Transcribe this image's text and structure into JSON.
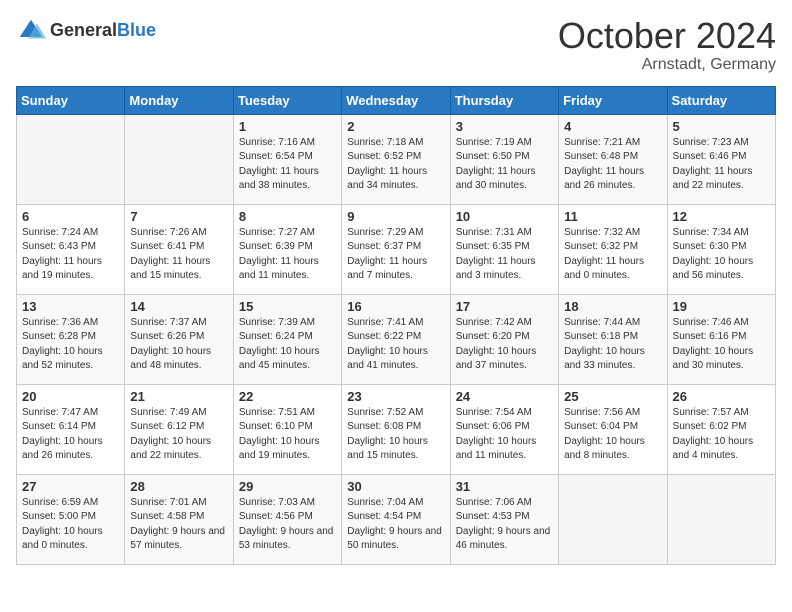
{
  "header": {
    "logo_general": "General",
    "logo_blue": "Blue",
    "month_title": "October 2024",
    "location": "Arnstadt, Germany"
  },
  "days_of_week": [
    "Sunday",
    "Monday",
    "Tuesday",
    "Wednesday",
    "Thursday",
    "Friday",
    "Saturday"
  ],
  "weeks": [
    [
      {
        "date": "",
        "info": ""
      },
      {
        "date": "",
        "info": ""
      },
      {
        "date": "1",
        "info": "Sunrise: 7:16 AM\nSunset: 6:54 PM\nDaylight: 11 hours and 38 minutes."
      },
      {
        "date": "2",
        "info": "Sunrise: 7:18 AM\nSunset: 6:52 PM\nDaylight: 11 hours and 34 minutes."
      },
      {
        "date": "3",
        "info": "Sunrise: 7:19 AM\nSunset: 6:50 PM\nDaylight: 11 hours and 30 minutes."
      },
      {
        "date": "4",
        "info": "Sunrise: 7:21 AM\nSunset: 6:48 PM\nDaylight: 11 hours and 26 minutes."
      },
      {
        "date": "5",
        "info": "Sunrise: 7:23 AM\nSunset: 6:46 PM\nDaylight: 11 hours and 22 minutes."
      }
    ],
    [
      {
        "date": "6",
        "info": "Sunrise: 7:24 AM\nSunset: 6:43 PM\nDaylight: 11 hours and 19 minutes."
      },
      {
        "date": "7",
        "info": "Sunrise: 7:26 AM\nSunset: 6:41 PM\nDaylight: 11 hours and 15 minutes."
      },
      {
        "date": "8",
        "info": "Sunrise: 7:27 AM\nSunset: 6:39 PM\nDaylight: 11 hours and 11 minutes."
      },
      {
        "date": "9",
        "info": "Sunrise: 7:29 AM\nSunset: 6:37 PM\nDaylight: 11 hours and 7 minutes."
      },
      {
        "date": "10",
        "info": "Sunrise: 7:31 AM\nSunset: 6:35 PM\nDaylight: 11 hours and 3 minutes."
      },
      {
        "date": "11",
        "info": "Sunrise: 7:32 AM\nSunset: 6:32 PM\nDaylight: 11 hours and 0 minutes."
      },
      {
        "date": "12",
        "info": "Sunrise: 7:34 AM\nSunset: 6:30 PM\nDaylight: 10 hours and 56 minutes."
      }
    ],
    [
      {
        "date": "13",
        "info": "Sunrise: 7:36 AM\nSunset: 6:28 PM\nDaylight: 10 hours and 52 minutes."
      },
      {
        "date": "14",
        "info": "Sunrise: 7:37 AM\nSunset: 6:26 PM\nDaylight: 10 hours and 48 minutes."
      },
      {
        "date": "15",
        "info": "Sunrise: 7:39 AM\nSunset: 6:24 PM\nDaylight: 10 hours and 45 minutes."
      },
      {
        "date": "16",
        "info": "Sunrise: 7:41 AM\nSunset: 6:22 PM\nDaylight: 10 hours and 41 minutes."
      },
      {
        "date": "17",
        "info": "Sunrise: 7:42 AM\nSunset: 6:20 PM\nDaylight: 10 hours and 37 minutes."
      },
      {
        "date": "18",
        "info": "Sunrise: 7:44 AM\nSunset: 6:18 PM\nDaylight: 10 hours and 33 minutes."
      },
      {
        "date": "19",
        "info": "Sunrise: 7:46 AM\nSunset: 6:16 PM\nDaylight: 10 hours and 30 minutes."
      }
    ],
    [
      {
        "date": "20",
        "info": "Sunrise: 7:47 AM\nSunset: 6:14 PM\nDaylight: 10 hours and 26 minutes."
      },
      {
        "date": "21",
        "info": "Sunrise: 7:49 AM\nSunset: 6:12 PM\nDaylight: 10 hours and 22 minutes."
      },
      {
        "date": "22",
        "info": "Sunrise: 7:51 AM\nSunset: 6:10 PM\nDaylight: 10 hours and 19 minutes."
      },
      {
        "date": "23",
        "info": "Sunrise: 7:52 AM\nSunset: 6:08 PM\nDaylight: 10 hours and 15 minutes."
      },
      {
        "date": "24",
        "info": "Sunrise: 7:54 AM\nSunset: 6:06 PM\nDaylight: 10 hours and 11 minutes."
      },
      {
        "date": "25",
        "info": "Sunrise: 7:56 AM\nSunset: 6:04 PM\nDaylight: 10 hours and 8 minutes."
      },
      {
        "date": "26",
        "info": "Sunrise: 7:57 AM\nSunset: 6:02 PM\nDaylight: 10 hours and 4 minutes."
      }
    ],
    [
      {
        "date": "27",
        "info": "Sunrise: 6:59 AM\nSunset: 5:00 PM\nDaylight: 10 hours and 0 minutes."
      },
      {
        "date": "28",
        "info": "Sunrise: 7:01 AM\nSunset: 4:58 PM\nDaylight: 9 hours and 57 minutes."
      },
      {
        "date": "29",
        "info": "Sunrise: 7:03 AM\nSunset: 4:56 PM\nDaylight: 9 hours and 53 minutes."
      },
      {
        "date": "30",
        "info": "Sunrise: 7:04 AM\nSunset: 4:54 PM\nDaylight: 9 hours and 50 minutes."
      },
      {
        "date": "31",
        "info": "Sunrise: 7:06 AM\nSunset: 4:53 PM\nDaylight: 9 hours and 46 minutes."
      },
      {
        "date": "",
        "info": ""
      },
      {
        "date": "",
        "info": ""
      }
    ]
  ]
}
